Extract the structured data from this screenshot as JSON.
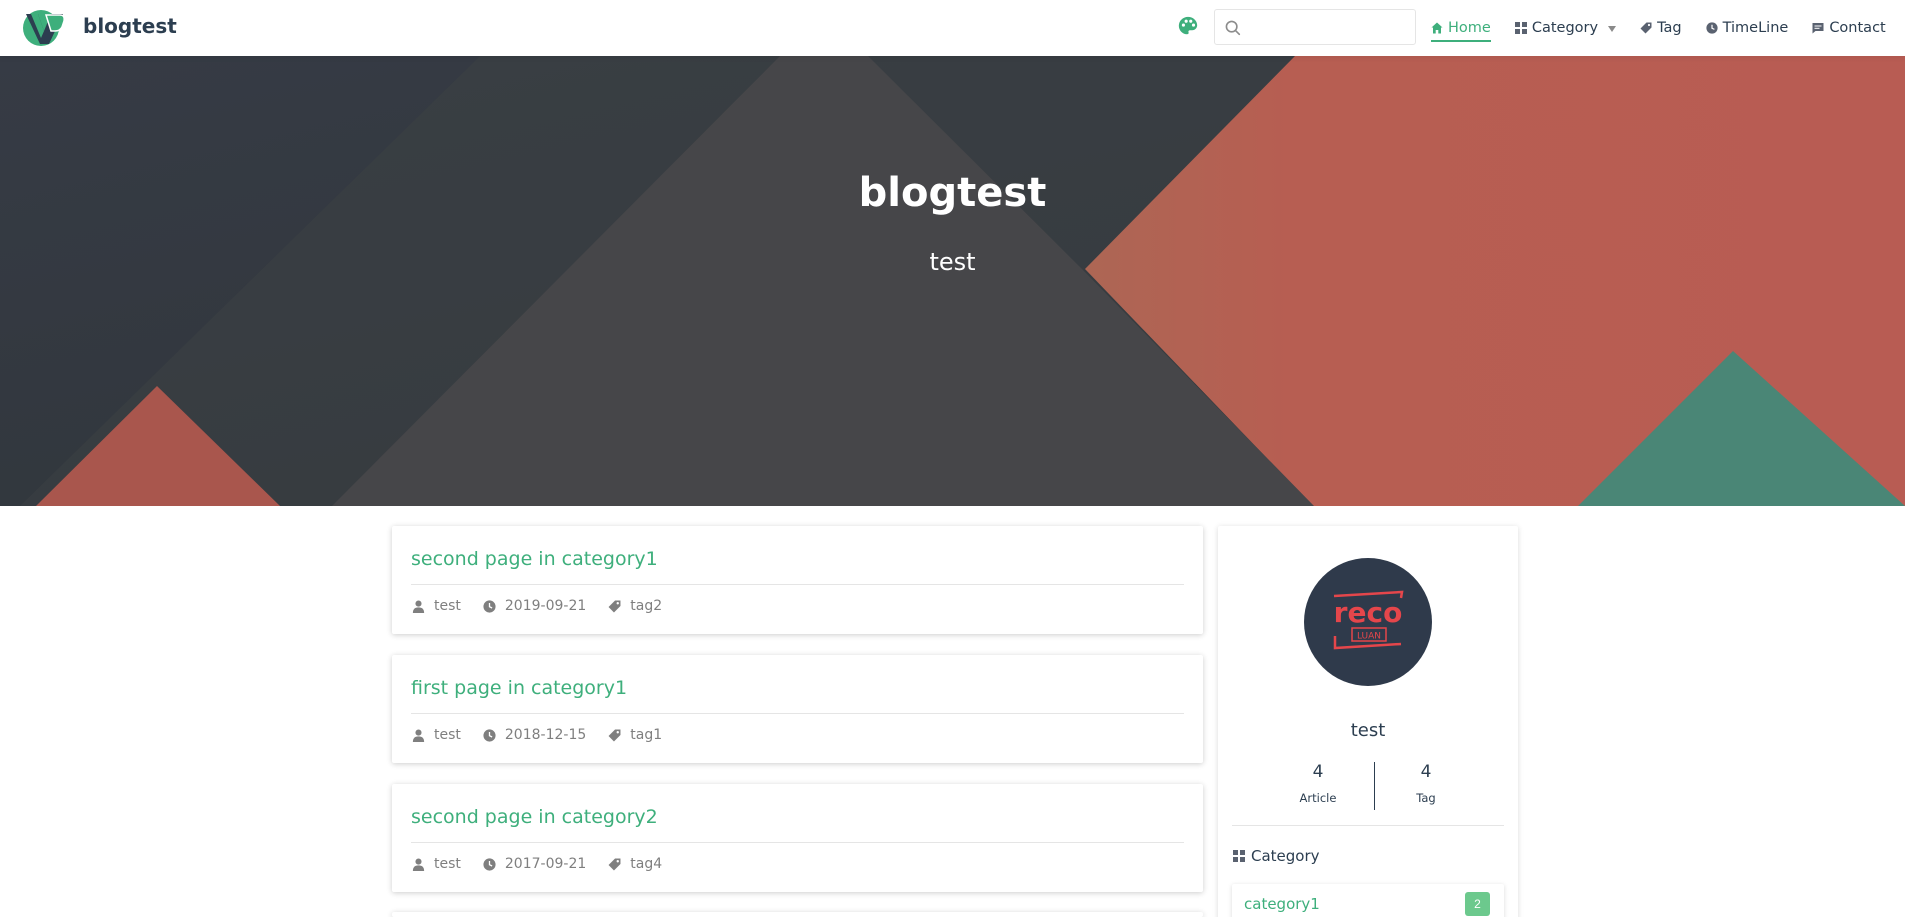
{
  "navbar": {
    "site_name": "blogtest",
    "search": {
      "placeholder": "",
      "value": ""
    },
    "items": [
      {
        "label": "Home",
        "icon": "home-icon",
        "active": true
      },
      {
        "label": "Category",
        "icon": "grid-icon",
        "has_dropdown": true
      },
      {
        "label": "Tag",
        "icon": "tag-icon"
      },
      {
        "label": "TimeLine",
        "icon": "clock-icon"
      },
      {
        "label": "Contact",
        "icon": "message-icon"
      }
    ]
  },
  "hero": {
    "title": "blogtest",
    "subtitle": "test"
  },
  "posts": [
    {
      "title": "second page in category1",
      "author": "test",
      "date": "2019-09-21",
      "tag": "tag2"
    },
    {
      "title": "first page in category1",
      "author": "test",
      "date": "2018-12-15",
      "tag": "tag1"
    },
    {
      "title": "second page in category2",
      "author": "test",
      "date": "2017-09-21",
      "tag": "tag4"
    },
    {
      "title": "",
      "author": "",
      "date": "",
      "tag": ""
    }
  ],
  "sidebar": {
    "avatar_text": {
      "main": "reco",
      "sub": "LUAN"
    },
    "author": "test",
    "stats": [
      {
        "num": "4",
        "label": "Article"
      },
      {
        "num": "4",
        "label": "Tag"
      }
    ],
    "category_heading": "Category",
    "categories": [
      {
        "name": "category1",
        "count": "2"
      }
    ]
  },
  "colors": {
    "accent": "#3eaf7c",
    "badge": "#6cc98d",
    "hero_dark": "#3b4049",
    "hero_red": "#b95c53",
    "hero_teal": "#4a8676"
  }
}
